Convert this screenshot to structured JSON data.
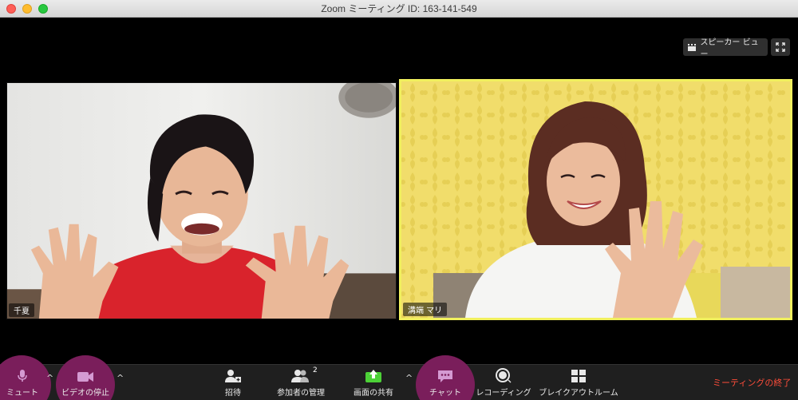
{
  "window": {
    "title": "Zoom ミーティング ID: 163-141-549"
  },
  "top_controls": {
    "view_label": "スピーカー ビュー",
    "view_icon": "speaker-view-icon",
    "fullscreen_icon": "fullscreen-icon"
  },
  "participants": [
    {
      "name": "千夏",
      "active_speaker": false
    },
    {
      "name": "溝端 マリ",
      "active_speaker": true
    }
  ],
  "toolbar": {
    "mute_label": "ミュート",
    "video_label": "ビデオの停止",
    "invite_label": "招待",
    "participants_label": "参加者の管理",
    "participants_count": "2",
    "share_label": "画面の共有",
    "chat_label": "チャット",
    "record_label": "レコーディング",
    "breakout_label": "ブレイクアウトルーム",
    "end_label": "ミーティングの終了"
  },
  "colors": {
    "highlight": "#7a1e5b",
    "active_border": "#f1f05e",
    "end": "#ff4d3a",
    "share_green": "#4cd137"
  }
}
